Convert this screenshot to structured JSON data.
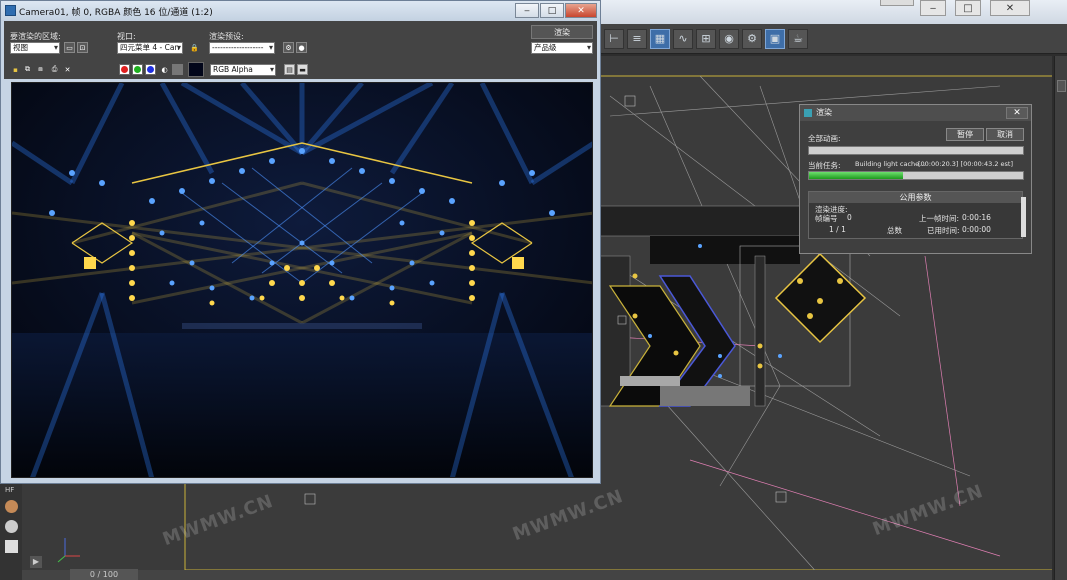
{
  "render_window": {
    "title": "Camera01, 帧 0, RGBA 颜色 16 位/通道 (1:2)",
    "area_label": "要渲染的区域:",
    "area_value": "视图",
    "viewport_label": "视口:",
    "viewport_value": "四元菜单 4 - Can",
    "preset_label": "渲染预设:",
    "preset_value": "-------------------",
    "render_button": "渲染",
    "quality_value": "产品级",
    "channel_value": "RGB Alpha",
    "sys_minimize": "‒",
    "sys_maximize": "□",
    "sys_close": "✕"
  },
  "progress_dialog": {
    "title": "渲染",
    "close": "✕",
    "all_animation_label": "全部动画:",
    "pause_button": "暂停",
    "cancel_button": "取消",
    "all_animation_progress": 0.0,
    "current_task_label": "当前任务:",
    "current_task_text": "Building light cache...",
    "current_task_time": "[00:00:20.3] [00:00:43.2 est]",
    "current_task_progress": 0.44,
    "group_title": "公用参数",
    "render_progress_label": "渲染进度:",
    "frame_number_label": "帧编号",
    "frame_number_value": "0",
    "frame_progress": "1 / 1",
    "total_label": "总数",
    "last_frame_time_label": "上一帧时间:",
    "last_frame_time_value": "0:00:16",
    "elapsed_time_label": "已用时间:",
    "elapsed_time_value": "0:00:00"
  },
  "timeline": {
    "frame_counter": "0 / 100"
  },
  "watermarks": [
    "MWMW.CN",
    "MWMW.CN",
    "MWMW.CN"
  ],
  "colors": {
    "render_bg": "#050b1a",
    "beam_blue": "#2e7cf0",
    "beam_yellow": "#e8c542",
    "progress_green": "#2db82d",
    "viewport_frame": "#c9b23a"
  }
}
